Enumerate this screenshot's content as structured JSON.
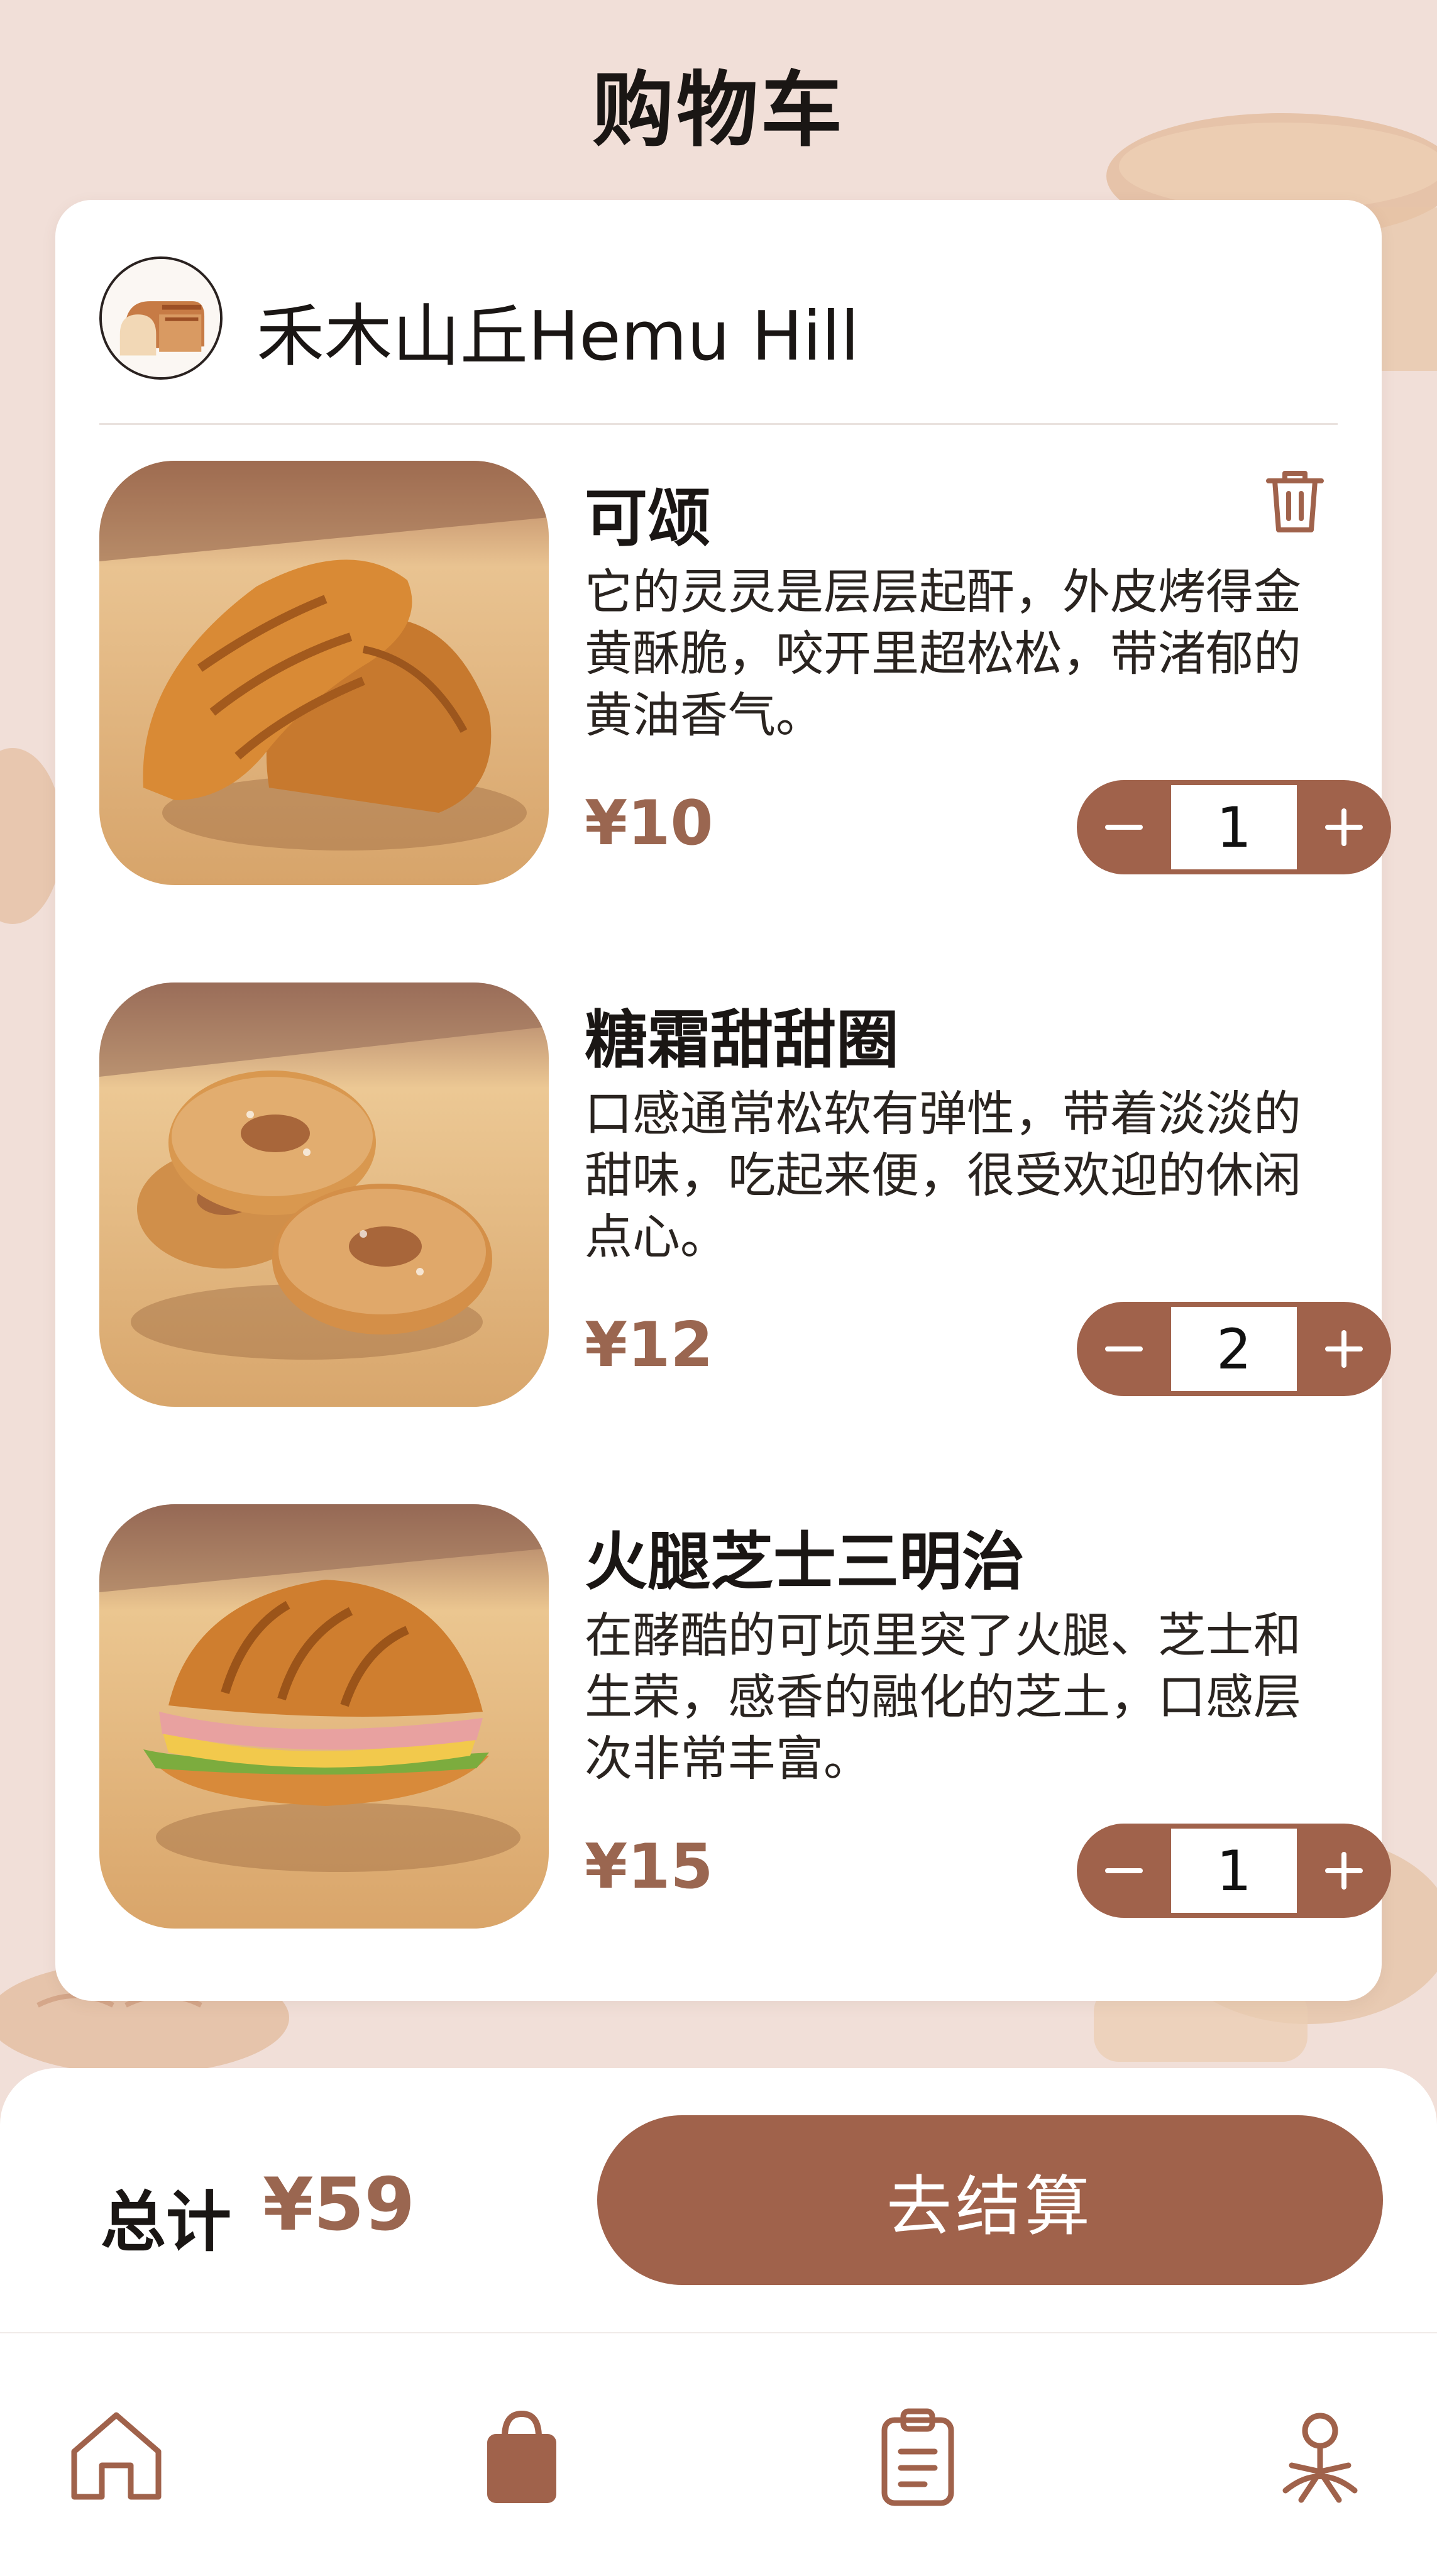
{
  "header": {
    "title": "购物车"
  },
  "store": {
    "name": "禾木山丘Hemu Hill",
    "avatar_icon": "bread-loaf-icon"
  },
  "cart": {
    "items": [
      {
        "name": "可颂",
        "description": "它的灵灵是层层起酐，外皮烤得金黄酥脆，咬开里超松松，带渚郁的黄油香气。",
        "price": "¥10",
        "quantity": "1",
        "image_icon": "croissant-photo"
      },
      {
        "name": "糖霜甜甜圈",
        "description": "口感通常松软有弹性，带着淡淡的甜味，吃起来便，很受欢迎的休闲点心。",
        "price": "¥12",
        "quantity": "2",
        "image_icon": "donut-photo"
      },
      {
        "name": "火腿芝士三明治",
        "description": "在酵酷的可顷里突了火腿、芝士和生荣，感香的融化的芝土，口感层次非常丰富。",
        "price": "¥15",
        "quantity": "1",
        "image_icon": "croissant-sandwich-photo"
      }
    ],
    "delete_icon": "trash-icon",
    "minus_icon": "minus-icon",
    "plus_icon": "plus-icon"
  },
  "checkout": {
    "total_label": "总计",
    "total_value": "¥59",
    "button_label": "去结算"
  },
  "tabbar": {
    "tabs": [
      {
        "icon": "home-icon",
        "active": false
      },
      {
        "icon": "shopping-bag-icon",
        "active": true
      },
      {
        "icon": "clipboard-icon",
        "active": false
      },
      {
        "icon": "profile-icon",
        "active": false
      }
    ]
  },
  "colors": {
    "accent": "#a0624b",
    "price": "#9a6650",
    "background": "#f1dfd8",
    "card": "#ffffff"
  }
}
